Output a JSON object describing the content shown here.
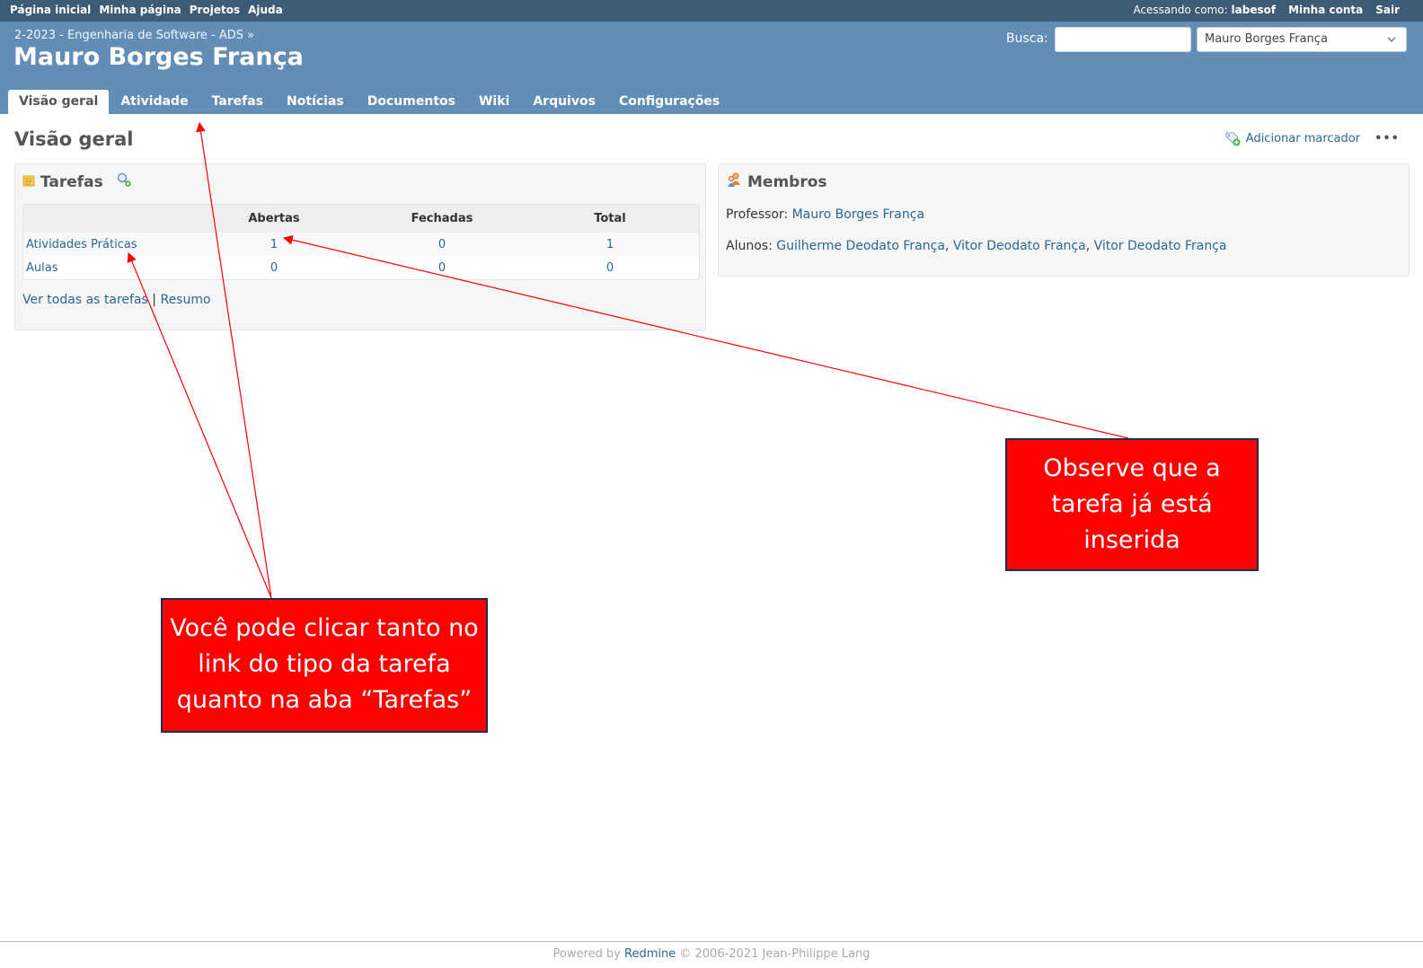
{
  "top_menu": {
    "items": [
      "Página inicial",
      "Minha página",
      "Projetos",
      "Ajuda"
    ],
    "logged_as_label": "Acessando como:",
    "user": "labesof",
    "my_account": "Minha conta",
    "logout": "Sair"
  },
  "header": {
    "breadcrumb": "2-2023 - Engenharia de Software - ADS »",
    "title": "Mauro Borges França",
    "search_label": "Busca:",
    "search_value": "",
    "jump_selected": "Mauro Borges França"
  },
  "main_menu": {
    "tabs": [
      "Visão geral",
      "Atividade",
      "Tarefas",
      "Notícias",
      "Documentos",
      "Wiki",
      "Arquivos",
      "Configurações"
    ],
    "selected": "Visão geral"
  },
  "page": {
    "title": "Visão geral",
    "add_bookmark": "Adicionar marcador",
    "more": "•••"
  },
  "issues": {
    "title": "Tarefas",
    "columns": [
      "",
      "Abertas",
      "Fechadas",
      "Total"
    ],
    "rows": [
      {
        "tracker": "Atividades Práticas",
        "open": "1",
        "closed": "0",
        "total": "1"
      },
      {
        "tracker": "Aulas",
        "open": "0",
        "closed": "0",
        "total": "0"
      }
    ],
    "view_all": "Ver todas as tarefas",
    "separator": "|",
    "summary": "Resumo"
  },
  "members": {
    "title": "Membros",
    "professor_label": "Professor:",
    "professor": "Mauro Borges França",
    "students_label": "Alunos:",
    "students": [
      "Guilherme Deodato França",
      "Vitor Deodato França",
      "Vitor Deodato França"
    ]
  },
  "callouts": {
    "left": "Você pode clicar tanto no link do tipo da tarefa quanto na aba “Tarefas”",
    "right": "Observe que a tarefa já está inserida"
  },
  "footer": {
    "powered_by": "Powered by",
    "redmine": "Redmine",
    "copyright": "© 2006-2021 Jean-Philippe Lang"
  },
  "colors": {
    "top_menu": "#3e5b76",
    "header": "#628db6",
    "link": "#2b6693",
    "callout": "#ff0000"
  }
}
